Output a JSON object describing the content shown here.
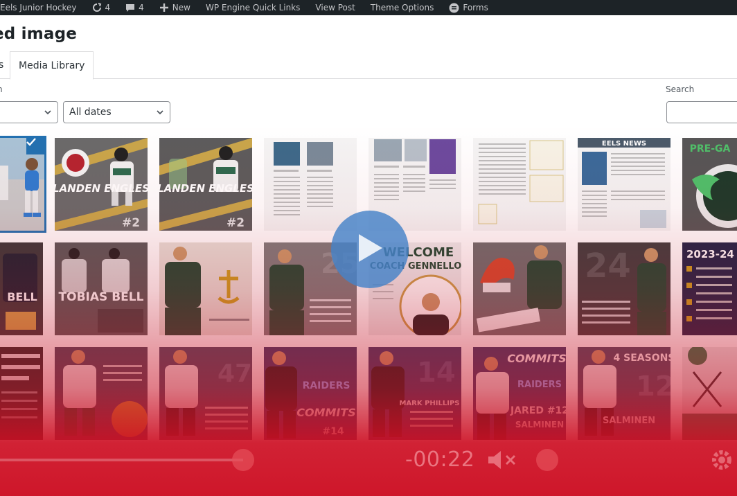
{
  "admin_bar": {
    "site_name": "Eels Junior Hockey",
    "updates_count": "4",
    "comments_count": "4",
    "new_label": "New",
    "quick_links_label": "WP Engine Quick Links",
    "view_post_label": "View Post",
    "theme_options_label": "Theme Options",
    "forms_label": "Forms"
  },
  "modal": {
    "title": "ed image",
    "tabs": {
      "upload_fragment": "s",
      "media_library": "Media Library"
    },
    "filter_label_fragment": "n",
    "type_filter_value": "",
    "date_filter_value": "All dates",
    "search_label": "Search",
    "search_value": ""
  },
  "tile_texts": {
    "engles_name": "LANDEN ENGLES",
    "engles_number": "#2",
    "tobias_name": "TOBIAS BELL",
    "bell_name": "BELL",
    "welcome_line1": "WELCOME",
    "welcome_line2": "COACH GENNELLO",
    "commits": "COMMITS",
    "raiders": "RAIDERS",
    "number_14": "#14",
    "mark_phillips": "MARK PHILLIPS",
    "jared": "JARED #12",
    "salminen": "SALMINEN",
    "four_seasons": "4 SEASONS",
    "pre_game": "PRE-GA",
    "season_2023": "2023-24",
    "eels_news": "EELS NEWS"
  },
  "video": {
    "time_display": "-00:22",
    "progress_fraction": 0.33
  },
  "colors": {
    "admin_bar_bg": "#1d2327",
    "accent": "#2271b1",
    "overlay_red": "#cd0f23",
    "play_button": "#4682c8"
  },
  "icons": [
    "refresh-icon",
    "comment-icon",
    "plus-icon",
    "forms-icon",
    "chevron-down-icon",
    "checkmark-icon",
    "play-icon",
    "mute-icon",
    "gear-icon"
  ]
}
